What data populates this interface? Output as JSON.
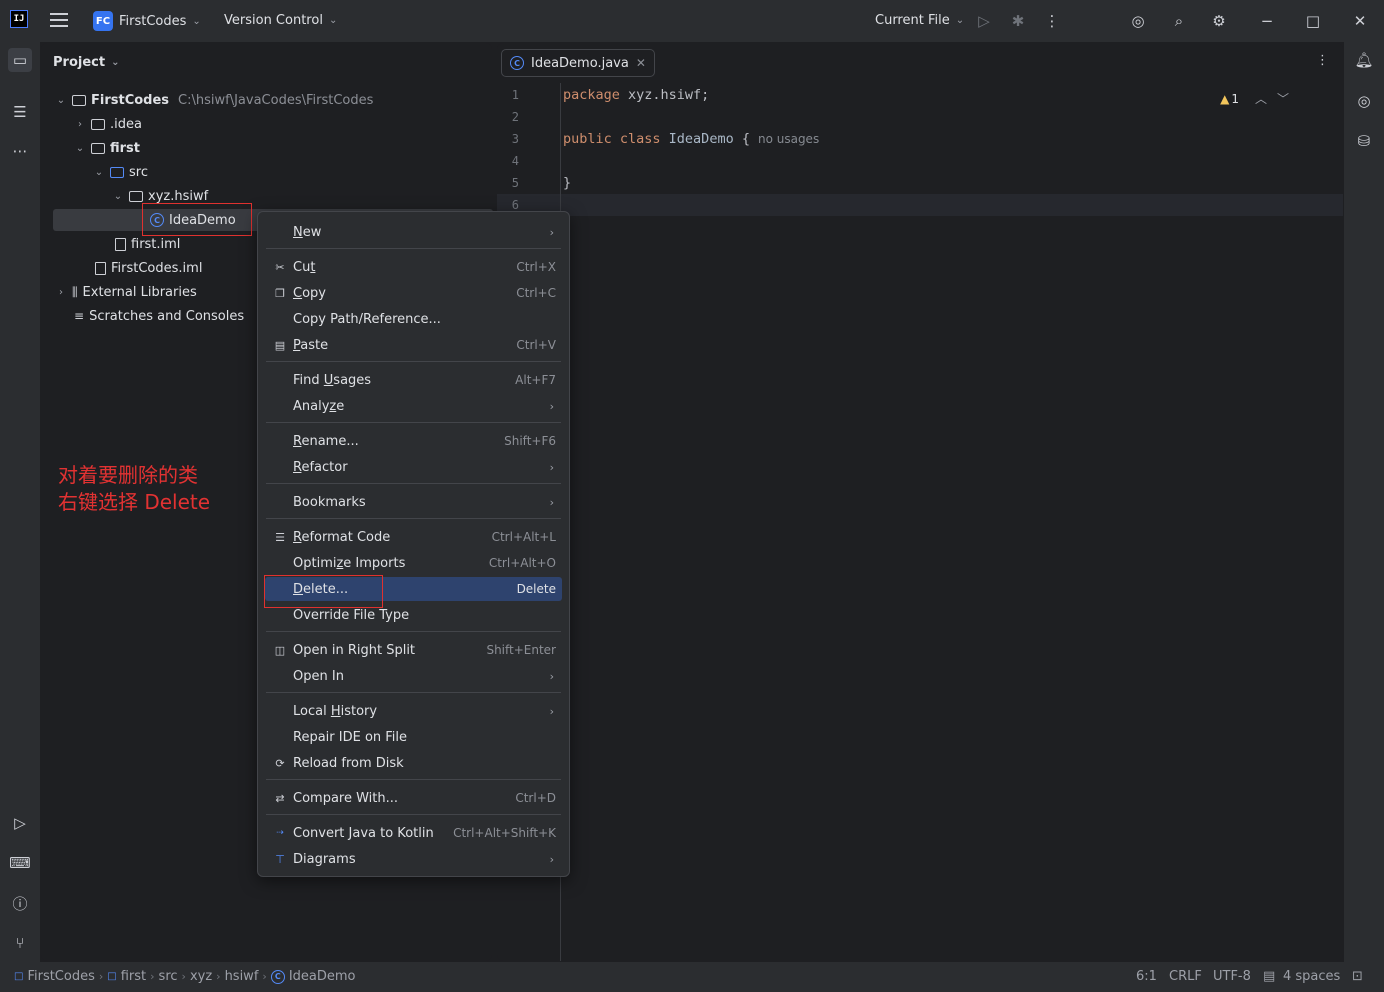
{
  "titlebar": {
    "project_badge": "FC",
    "project_name": "FirstCodes",
    "vcs_label": "Version Control",
    "run_config": "Current File"
  },
  "project_panel": {
    "title": "Project",
    "tree": [
      {
        "label": "FirstCodes",
        "path": "C:\\hsiwf\\JavaCodes\\FirstCodes",
        "type": "module",
        "expanded": true
      },
      {
        "label": ".idea",
        "type": "folder",
        "expanded": false
      },
      {
        "label": "first",
        "type": "module",
        "expanded": true
      },
      {
        "label": "src",
        "type": "source-folder",
        "expanded": true
      },
      {
        "label": "xyz.hsiwf",
        "type": "package",
        "expanded": true
      },
      {
        "label": "IdeaDemo",
        "type": "class",
        "selected": true
      },
      {
        "label": "first.iml",
        "type": "file"
      },
      {
        "label": "FirstCodes.iml",
        "type": "file"
      },
      {
        "label": "External Libraries",
        "type": "libraries",
        "expanded": false
      },
      {
        "label": "Scratches and Consoles",
        "type": "scratches"
      }
    ]
  },
  "annotation": {
    "line1": "对着要删除的类",
    "line2": "右键选择 Delete"
  },
  "editor": {
    "tab_label": "IdeaDemo.java",
    "warning_count": "1",
    "line_numbers": [
      "1",
      "2",
      "3",
      "4",
      "5",
      "6"
    ],
    "code": {
      "line1_kw": "package",
      "line1_rest": " xyz.hsiwf;",
      "line3_kw": "public class",
      "line3_name": " IdeaDemo",
      "line3_brace": " {",
      "line3_hint": "no usages",
      "line5": "}"
    }
  },
  "context_menu": {
    "items": [
      {
        "label": "New",
        "shortcut": "",
        "submenu": true
      },
      {
        "label": "Cut",
        "shortcut": "Ctrl+X",
        "icon": "scissors-icon"
      },
      {
        "label": "Copy",
        "shortcut": "Ctrl+C",
        "icon": "copy-icon"
      },
      {
        "label": "Copy Path/Reference...",
        "shortcut": ""
      },
      {
        "label": "Paste",
        "shortcut": "Ctrl+V",
        "icon": "paste-icon"
      },
      {
        "label": "Find Usages",
        "shortcut": "Alt+F7"
      },
      {
        "label": "Analyze",
        "shortcut": "",
        "submenu": true
      },
      {
        "label": "Rename...",
        "shortcut": "Shift+F6"
      },
      {
        "label": "Refactor",
        "shortcut": "",
        "submenu": true
      },
      {
        "label": "Bookmarks",
        "shortcut": "",
        "submenu": true
      },
      {
        "label": "Reformat Code",
        "shortcut": "Ctrl+Alt+L",
        "icon": "reformat-icon"
      },
      {
        "label": "Optimize Imports",
        "shortcut": "Ctrl+Alt+O"
      },
      {
        "label": "Delete...",
        "shortcut": "Delete",
        "highlighted": true
      },
      {
        "label": "Override File Type",
        "shortcut": ""
      },
      {
        "label": "Open in Right Split",
        "shortcut": "Shift+Enter",
        "icon": "split-icon"
      },
      {
        "label": "Open In",
        "shortcut": "",
        "submenu": true
      },
      {
        "label": "Local History",
        "shortcut": "",
        "submenu": true
      },
      {
        "label": "Repair IDE on File",
        "shortcut": ""
      },
      {
        "label": "Reload from Disk",
        "shortcut": "",
        "icon": "reload-icon"
      },
      {
        "label": "Compare With...",
        "shortcut": "Ctrl+D",
        "icon": "compare-icon"
      },
      {
        "label": "Convert Java to Kotlin",
        "shortcut": "Ctrl+Alt+Shift+K",
        "icon": "kotlin-convert-icon"
      },
      {
        "label": "Diagrams",
        "shortcut": "",
        "submenu": true,
        "icon": "diagram-icon"
      }
    ]
  },
  "statusbar": {
    "breadcrumbs": [
      "FirstCodes",
      "first",
      "src",
      "xyz",
      "hsiwf",
      "IdeaDemo"
    ],
    "position": "6:1",
    "line_ending": "CRLF",
    "encoding": "UTF-8",
    "indent": "4 spaces"
  },
  "colors": {
    "accent": "#3574f0",
    "highlight": "#2e436e",
    "annotation_red": "#e23232",
    "keyword": "#cf8e6d"
  }
}
